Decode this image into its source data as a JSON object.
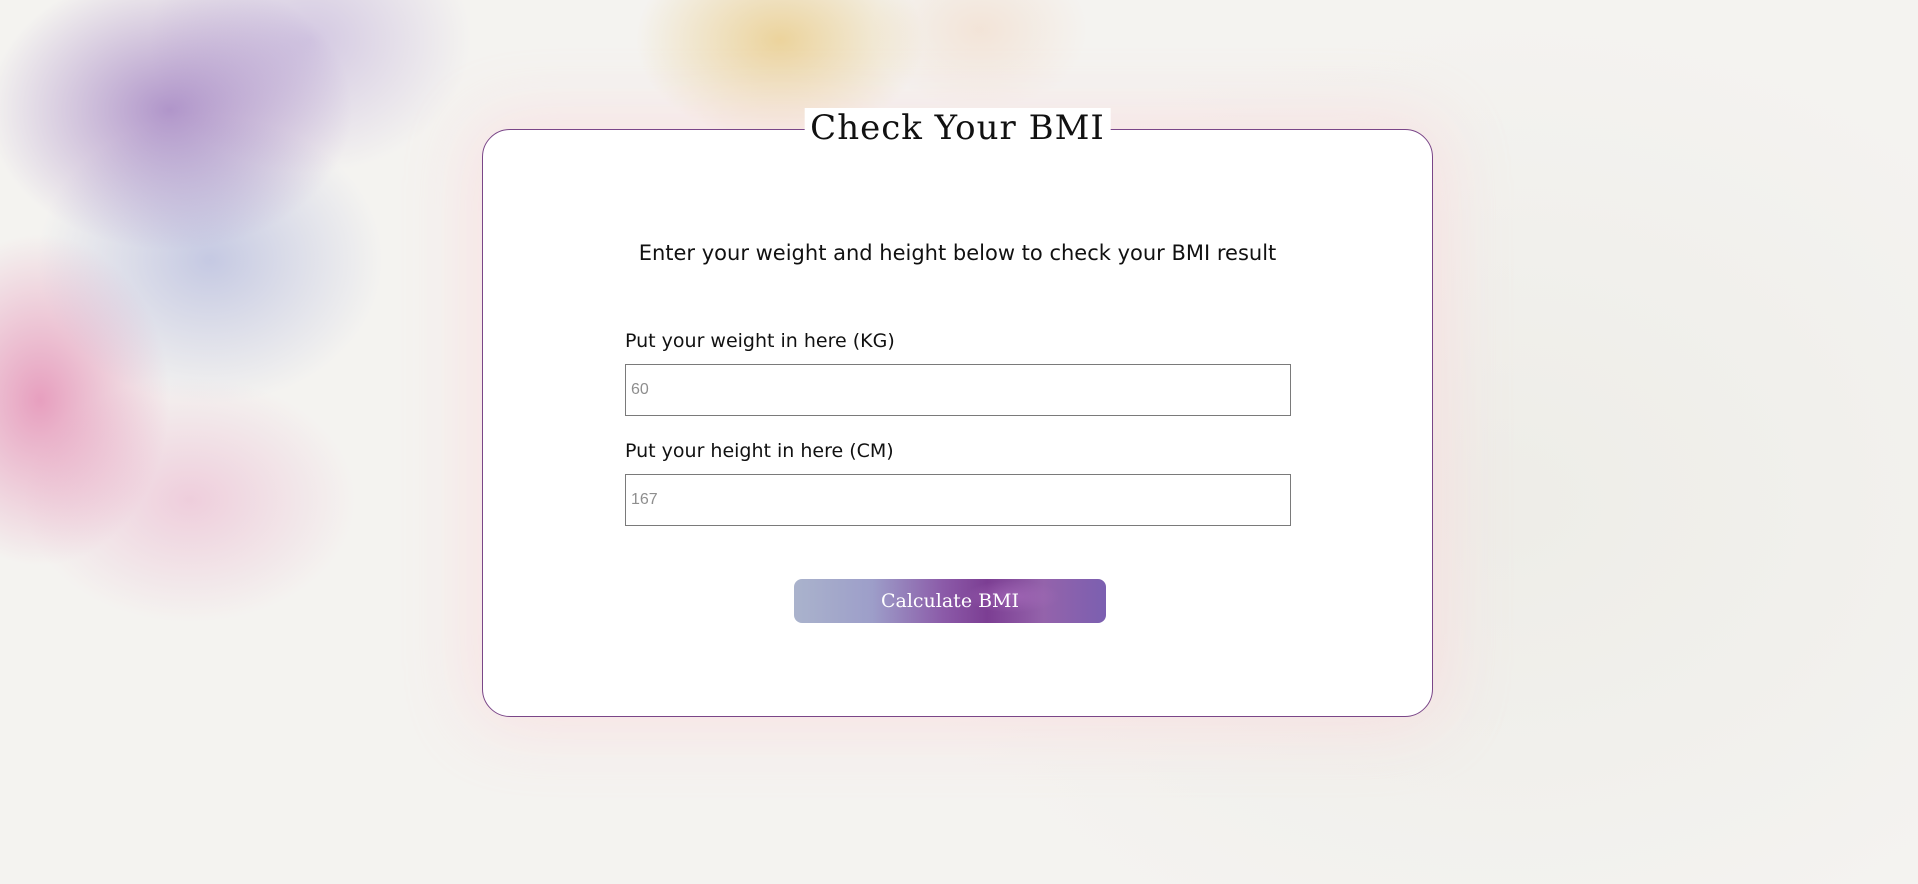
{
  "card": {
    "title": "Check Your BMI",
    "intro": "Enter your weight and height below to check your BMI result"
  },
  "weight": {
    "label": "Put your weight in here (KG)",
    "placeholder": "60",
    "value": ""
  },
  "height": {
    "label": "Put your height in here (CM)",
    "placeholder": "167",
    "value": ""
  },
  "calculate": {
    "label": "Calculate BMI"
  },
  "colors": {
    "card_border": "#7a4688",
    "button_gradient": [
      "#aab3cc",
      "#9d9ec9",
      "#8b5aa8",
      "#7c3e93",
      "#7b5fb0"
    ],
    "background": "#f4f3f0"
  }
}
